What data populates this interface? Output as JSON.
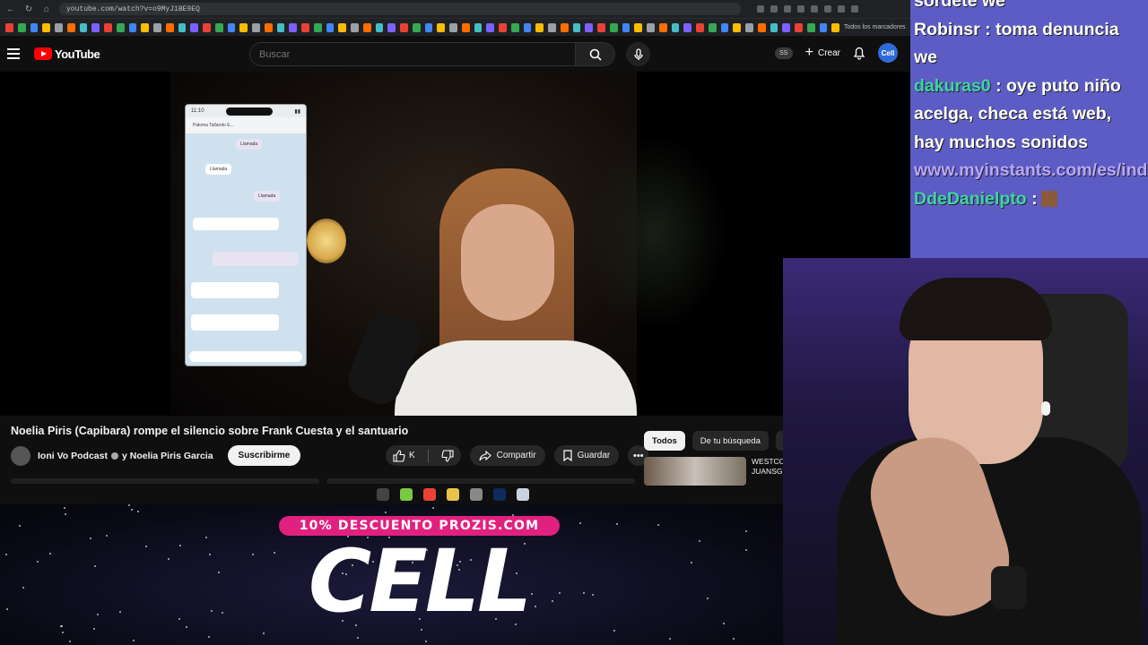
{
  "browser": {
    "url": "youtube.com/watch?v=o9MyJ1BE9EQ",
    "bookmarks_label": "Todos los marcadores"
  },
  "youtube": {
    "logo": "YouTube",
    "search_placeholder": "Buscar",
    "ss_badge": "SS",
    "create_label": "Crear",
    "avatar_label": "Cell"
  },
  "phone": {
    "time": "11:10",
    "chat_title": "Paloma Tallando E...",
    "bubbles": [
      "Llamada",
      "Llamada",
      "Llamada"
    ]
  },
  "video": {
    "title": "Noelia Piris (Capibara) rompe el silencio sobre Frank Cuesta y el santuario",
    "channel": "Ioni Vo Podcast",
    "channel_co": "y Noelia Piris Garcia",
    "subscribe": "Suscribirme",
    "likes": "K",
    "share": "Compartir",
    "save": "Guardar"
  },
  "chips": [
    "Todos",
    "De tu búsqueda",
    "Ioi"
  ],
  "recommendation": {
    "title_line1": "WESTCO",
    "title_line2": "JUANSG"
  },
  "chat": {
    "lines": [
      {
        "user": "",
        "message": "sordete we",
        "color": "#ffffff"
      },
      {
        "user": "Robinsr",
        "message": ": toma denuncia we",
        "color": "#ffffff"
      },
      {
        "user": "dakuras0",
        "message": ": oye puto niño acelga, checa está web, hay muchos sonidos",
        "color": "#3fd4a6"
      },
      {
        "user": "",
        "message": "www.myinstants.com/es/index/ar/",
        "color": "#b8a7ff"
      },
      {
        "user": "DdeDanielpto",
        "message": ":",
        "color": "#3fd4a6"
      }
    ]
  },
  "banner": {
    "promo": "10% DESCUENTO PROZIS.COM",
    "brand": "CELL",
    "promo_color": "#e0217f"
  }
}
